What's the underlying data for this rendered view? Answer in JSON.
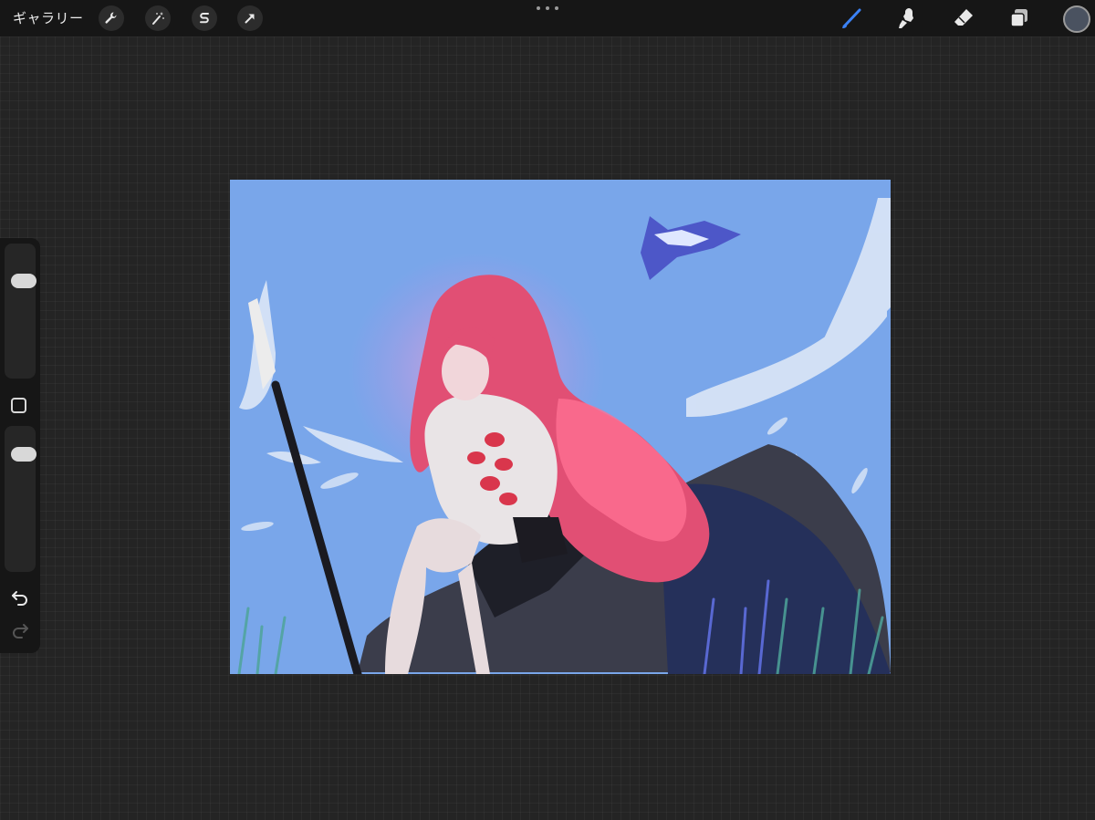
{
  "app": {
    "gallery_label": "ギャラリー"
  },
  "toolbar": {
    "left_tools": [
      {
        "icon": "wrench-icon",
        "name": "actions"
      },
      {
        "icon": "magic-wand-icon",
        "name": "adjustments"
      },
      {
        "icon": "selection-s-icon",
        "name": "selection"
      },
      {
        "icon": "arrow-cursor-icon",
        "name": "transform"
      }
    ],
    "right_tools": [
      {
        "icon": "brush-icon",
        "name": "paint",
        "active": true
      },
      {
        "icon": "smudge-icon",
        "name": "smudge"
      },
      {
        "icon": "eraser-icon",
        "name": "erase"
      },
      {
        "icon": "layers-icon",
        "name": "layers"
      }
    ],
    "current_color": "#4a5260",
    "active_tool_color": "#3b82f6"
  },
  "sidebar": {
    "brush_size_level": 0.25,
    "opacity_level": 0.16
  },
  "colors": {
    "workspace": "#242424",
    "bar": "#161616",
    "sky": "#79a6ea",
    "hair": "#e14f74"
  }
}
